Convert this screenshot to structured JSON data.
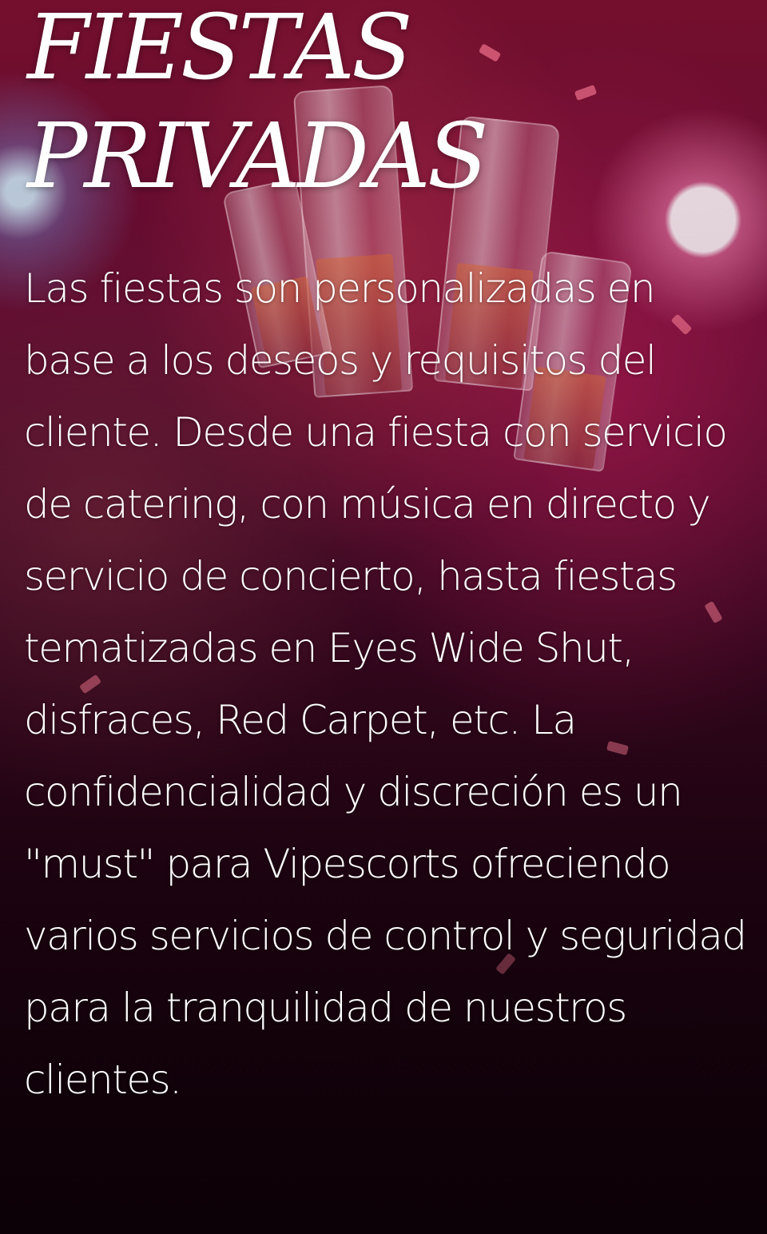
{
  "section": {
    "title_line_1": "FIESTAS",
    "title_line_2": "PRIVADAS",
    "description": "Las fiestas son personalizadas en base a los deseos y requisitos del cliente. Desde una fiesta con servicio de catering, con música en directo y servicio de concierto, hasta fiestas tematizadas en Eyes Wide Shut, disfraces, Red Carpet, etc. La confidencialidad y discreción es un \"must\" para Vipescorts ofreciendo varios servicios de control y seguridad para la tranquilidad de nuestros clientes."
  },
  "colors": {
    "text": "#ffffff",
    "background_dark": "#1a0410",
    "background_accent": "#7a1030"
  }
}
